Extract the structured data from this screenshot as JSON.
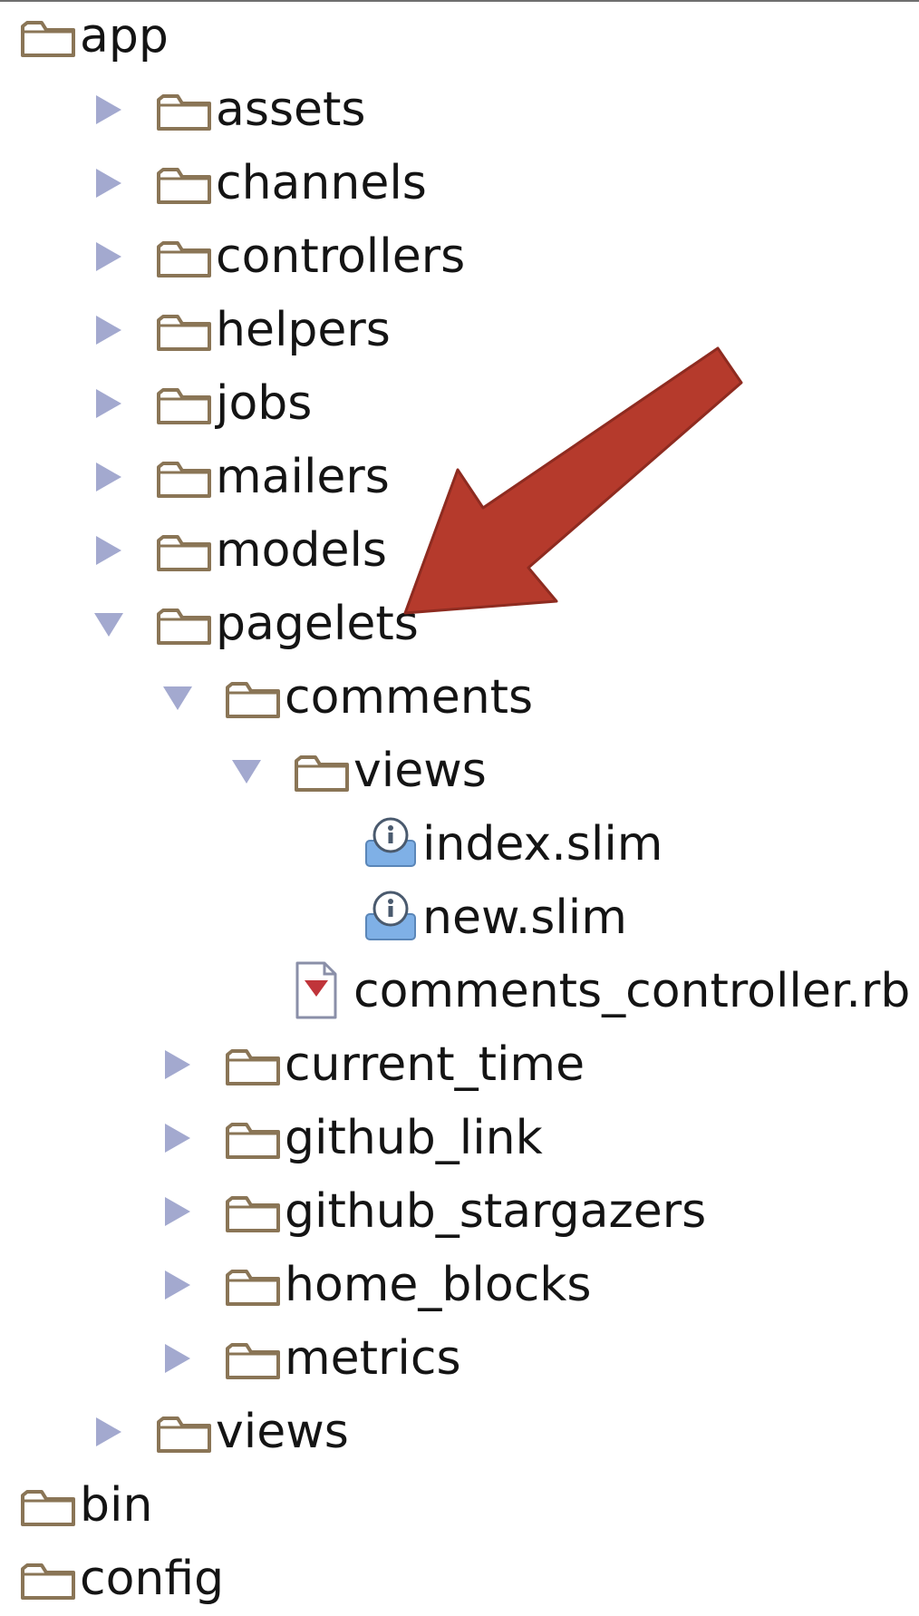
{
  "tree": {
    "rows": [
      {
        "label": "app",
        "kind": "folder",
        "toggle": "none",
        "depth": 0
      },
      {
        "label": "assets",
        "kind": "folder",
        "toggle": "collapsed",
        "depth": 1
      },
      {
        "label": "channels",
        "kind": "folder",
        "toggle": "collapsed",
        "depth": 1
      },
      {
        "label": "controllers",
        "kind": "folder",
        "toggle": "collapsed",
        "depth": 1
      },
      {
        "label": "helpers",
        "kind": "folder",
        "toggle": "collapsed",
        "depth": 1
      },
      {
        "label": "jobs",
        "kind": "folder",
        "toggle": "collapsed",
        "depth": 1
      },
      {
        "label": "mailers",
        "kind": "folder",
        "toggle": "collapsed",
        "depth": 1
      },
      {
        "label": "models",
        "kind": "folder",
        "toggle": "collapsed",
        "depth": 1
      },
      {
        "label": "pagelets",
        "kind": "folder",
        "toggle": "expanded",
        "depth": 1
      },
      {
        "label": "comments",
        "kind": "folder",
        "toggle": "expanded",
        "depth": 2
      },
      {
        "label": "views",
        "kind": "folder",
        "toggle": "expanded",
        "depth": 3
      },
      {
        "label": "index.slim",
        "kind": "slim-file",
        "toggle": "none",
        "depth": 4
      },
      {
        "label": "new.slim",
        "kind": "slim-file",
        "toggle": "none",
        "depth": 4
      },
      {
        "label": "comments_controller.rb",
        "kind": "ruby-file",
        "toggle": "none",
        "depth": 3
      },
      {
        "label": "current_time",
        "kind": "folder",
        "toggle": "collapsed",
        "depth": 2
      },
      {
        "label": "github_link",
        "kind": "folder",
        "toggle": "collapsed",
        "depth": 2
      },
      {
        "label": "github_stargazers",
        "kind": "folder",
        "toggle": "collapsed",
        "depth": 2
      },
      {
        "label": "home_blocks",
        "kind": "folder",
        "toggle": "collapsed",
        "depth": 2
      },
      {
        "label": "metrics",
        "kind": "folder",
        "toggle": "collapsed",
        "depth": 2
      },
      {
        "label": "views",
        "kind": "folder",
        "toggle": "collapsed",
        "depth": 1
      },
      {
        "label": "bin",
        "kind": "folder",
        "toggle": "none",
        "depth": 0
      },
      {
        "label": "config",
        "kind": "folder",
        "toggle": "none",
        "depth": 0
      }
    ]
  },
  "colors": {
    "folder_stroke": "#8a7556",
    "toggle": "#a3a9cf",
    "arrow": "#b53a2c",
    "arrow_dark": "#8e2b20",
    "text": "#141414",
    "slim_icon": "#7fb0e6",
    "ruby_icon": "#c0343a"
  },
  "icons": {
    "folder": "folder-icon",
    "slim-file": "slim-file-icon",
    "ruby-file": "ruby-file-icon",
    "collapsed": "disclosure-right-icon",
    "expanded": "disclosure-down-icon"
  }
}
